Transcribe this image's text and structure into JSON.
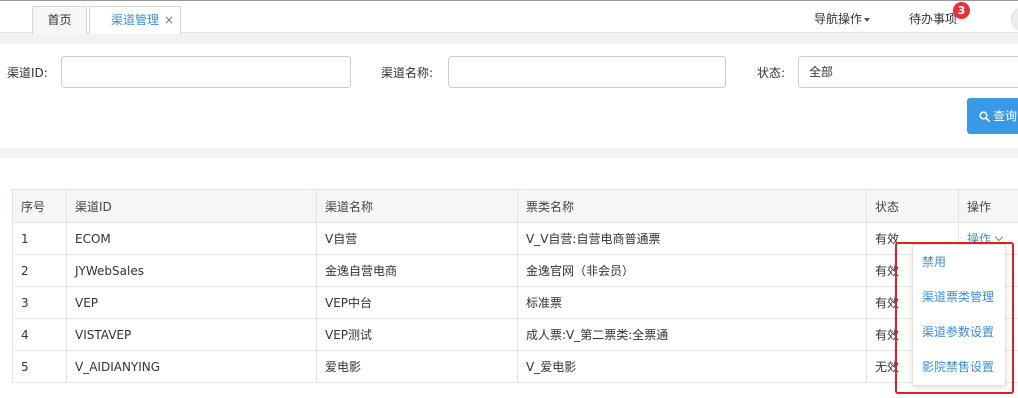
{
  "tabs": {
    "home": "首页",
    "active": "渠道管理",
    "close": "×"
  },
  "header": {
    "nav_ops": "导航操作",
    "todo": "待办事项",
    "todo_count": "3"
  },
  "search": {
    "channel_id_label": "渠道ID:",
    "channel_id_value": "",
    "channel_name_label": "渠道名称:",
    "channel_name_value": "",
    "status_label": "状态:",
    "status_value": "全部",
    "query_button": "查询"
  },
  "table": {
    "headers": [
      "序号",
      "渠道ID",
      "渠道名称",
      "票类名称",
      "状态",
      "操作"
    ],
    "rows": [
      {
        "no": "1",
        "id": "ECOM",
        "name": "V自营",
        "ticket": "V_V自营:自营电商普通票",
        "status": "有效",
        "op": "操作"
      },
      {
        "no": "2",
        "id": "JYWebSales",
        "name": "金逸自营电商",
        "ticket": "金逸官网（非会员）",
        "status": "有效",
        "op": ""
      },
      {
        "no": "3",
        "id": "VEP",
        "name": "VEP中台",
        "ticket": "标准票",
        "status": "有效",
        "op": ""
      },
      {
        "no": "4",
        "id": "VISTAVEP",
        "name": "VEP测试",
        "ticket": "成人票:V_第二票类:全票通",
        "status": "有效",
        "op": ""
      },
      {
        "no": "5",
        "id": "V_AIDIANYING",
        "name": "爱电影",
        "ticket": "V_爱电影",
        "status": "无效",
        "op": ""
      }
    ]
  },
  "dropdown": {
    "items": [
      "禁用",
      "渠道票类管理",
      "渠道参数设置",
      "影院禁售设置"
    ]
  },
  "colors": {
    "accent": "#3b8fd6",
    "button": "#3a99e6",
    "badge": "#e8303a",
    "highlight": "#e02020"
  }
}
